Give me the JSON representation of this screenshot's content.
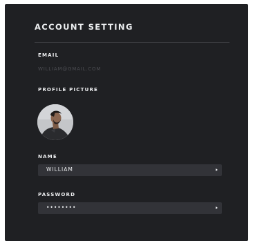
{
  "panel": {
    "title": "ACCOUNT SETTING"
  },
  "email": {
    "label": "EMAIL",
    "value": "WILLIAM@GMAIL.COM"
  },
  "profile_picture": {
    "label": "PROFILE PICTURE",
    "icon": "avatar-photo"
  },
  "name": {
    "label": "NAME",
    "value": "WILLIAM",
    "icon": "caret-right-icon"
  },
  "password": {
    "label": "PASSWORD",
    "value": "••••••••",
    "icon": "caret-right-icon"
  },
  "colors": {
    "panel_bg": "#1f2023",
    "field_bg": "#323338",
    "text": "#eceef0",
    "muted_text": "#4c4d52"
  }
}
